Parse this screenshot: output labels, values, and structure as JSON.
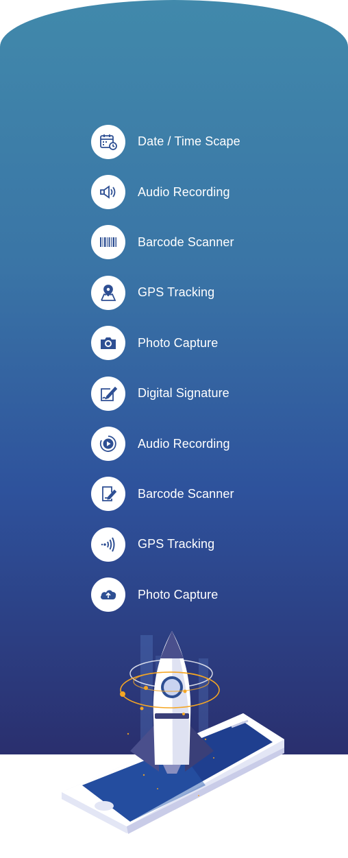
{
  "features": [
    {
      "label": "Date / Time Scape",
      "icon": "calendar-clock-icon"
    },
    {
      "label": "Audio Recording",
      "icon": "speaker-icon"
    },
    {
      "label": "Barcode Scanner",
      "icon": "barcode-icon"
    },
    {
      "label": "GPS Tracking",
      "icon": "map-pin-icon"
    },
    {
      "label": "Photo Capture",
      "icon": "camera-icon"
    },
    {
      "label": "Digital Signature",
      "icon": "signature-pen-icon"
    },
    {
      "label": "Audio Recording",
      "icon": "play-circle-icon"
    },
    {
      "label": "Barcode Scanner",
      "icon": "document-edit-icon"
    },
    {
      "label": "GPS Tracking",
      "icon": "signal-icon"
    },
    {
      "label": "Photo Capture",
      "icon": "cloud-upload-icon"
    }
  ],
  "colors": {
    "gradient_top": "#4189ab",
    "gradient_bottom": "#2a2f6e",
    "icon_color": "#2e4f93",
    "accent_orange": "#f5a623"
  }
}
